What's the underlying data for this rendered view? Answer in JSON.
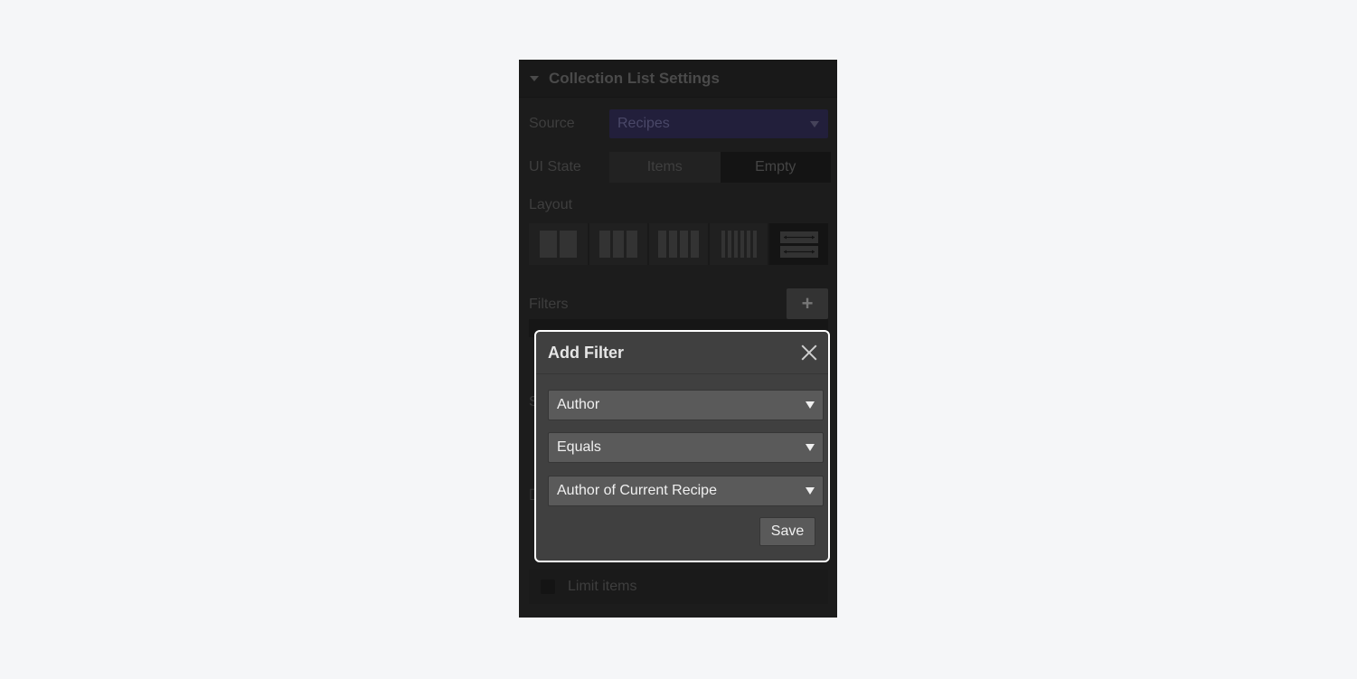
{
  "panel": {
    "title": "Collection List Settings",
    "source_label": "Source",
    "source_value": "Recipes",
    "ui_state_label": "UI State",
    "ui_state_options": [
      "Items",
      "Empty"
    ],
    "ui_state_selected": "Items",
    "layout_label": "Layout",
    "layout_options": [
      "2-columns",
      "3-columns",
      "4-columns",
      "6-columns",
      "full-width-rows"
    ],
    "layout_selected": "full-width-rows",
    "filters_label": "Filters",
    "add_filter_icon": "plus-icon",
    "limit_items_label": "Limit items"
  },
  "modal": {
    "title": "Add Filter",
    "close_icon": "close-icon",
    "field_value": "Author",
    "operator_value": "Equals",
    "target_value": "Author of Current Recipe",
    "save_label": "Save"
  },
  "colors": {
    "source_accent": "#221f3b",
    "modal_bg": "#404040",
    "modal_border": "#ffffff",
    "page_bg": "#f5f6f8"
  }
}
